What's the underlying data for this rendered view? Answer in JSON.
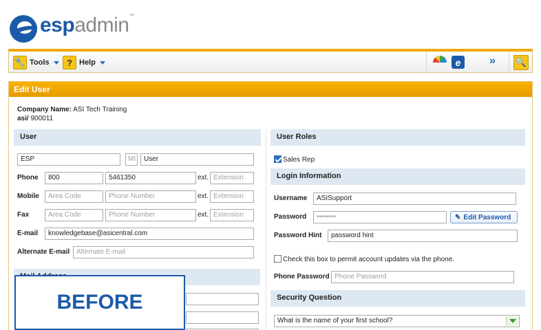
{
  "logo": {
    "esp": "esp",
    "admin": "admin",
    "tm": "™"
  },
  "toolbar": {
    "tools_label": "Tools",
    "help_label": "Help"
  },
  "panel": {
    "title": "Edit User"
  },
  "company": {
    "name_label": "Company Name:",
    "name_value": "ASI Tech Training",
    "asi_label": "asi/",
    "asi_value": "900011"
  },
  "user_section": {
    "title": "User",
    "first_name": "ESP",
    "mi_placeholder": "MI",
    "last_name": "User",
    "phone_label": "Phone",
    "phone_area": "800",
    "phone_number": "5461350",
    "ext_label": "ext.",
    "ext_placeholder": "Extension",
    "mobile_label": "Mobile",
    "area_placeholder": "Area Code",
    "number_placeholder": "Phone Number",
    "fax_label": "Fax",
    "email_label": "E-mail",
    "email_value": "knowledgebase@asicentral.com",
    "alt_email_label": "Alternate E-mail",
    "alt_email_placeholder": "Alternate E-mail",
    "mail_address_title": "Mail Address"
  },
  "roles": {
    "title": "User Roles",
    "sales_rep_label": "Sales Rep",
    "sales_rep_checked": true
  },
  "login": {
    "title": "Login Information",
    "username_label": "Username",
    "username_value": "ASISupport",
    "password_label": "Password",
    "password_value": "••••••••",
    "edit_password_label": "Edit Password",
    "hint_label": "Password Hint",
    "hint_value": "password hint",
    "phone_permit_label": "Check this box to permit account updates via the phone.",
    "phone_password_label": "Phone Password",
    "phone_password_placeholder": "Phone Password"
  },
  "security": {
    "title": "Security Question",
    "question_value": "What is the name of your first school?"
  },
  "overlay": {
    "before_label": "BEFORE"
  },
  "colors": {
    "brand_blue": "#1b5aa8",
    "accent_orange": "#f0a800",
    "section_bg": "#dde8f2"
  }
}
